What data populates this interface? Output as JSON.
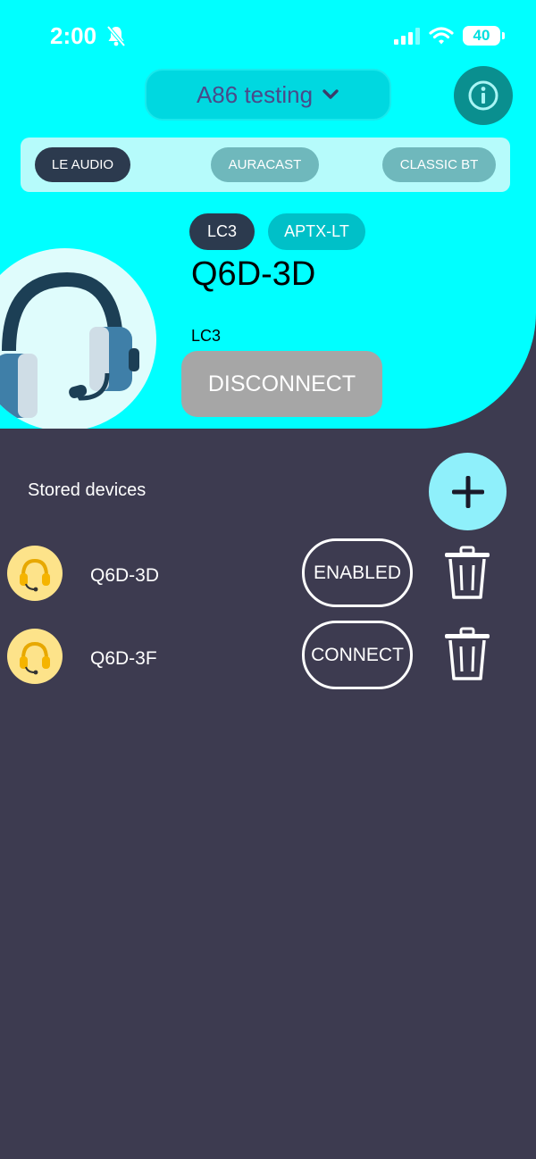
{
  "status_bar": {
    "time": "2:00",
    "battery": "40"
  },
  "header": {
    "device_selector": "A86 testing"
  },
  "modes": [
    "LE AUDIO",
    "AURACAST",
    "CLASSIC BT"
  ],
  "codecs": [
    "LC3",
    "APTX-LT"
  ],
  "current_device": {
    "name": "Q6D-3D",
    "codec": "LC3",
    "disconnect_label": "DISCONNECT"
  },
  "stored": {
    "title": "Stored devices",
    "devices": [
      {
        "name": "Q6D-3D",
        "action": "ENABLED"
      },
      {
        "name": "Q6D-3F",
        "action": "CONNECT"
      }
    ]
  },
  "colors": {
    "accent": "#00ffff",
    "background": "#3d3b50",
    "active_pill": "#2c3a4e",
    "disconnect": "#a6a6a6"
  },
  "icons": [
    "bell-slash-icon",
    "signal-icon",
    "wifi-icon",
    "battery-icon",
    "chevron-down-icon",
    "info-icon",
    "headset-icon",
    "plus-icon",
    "trash-icon"
  ]
}
